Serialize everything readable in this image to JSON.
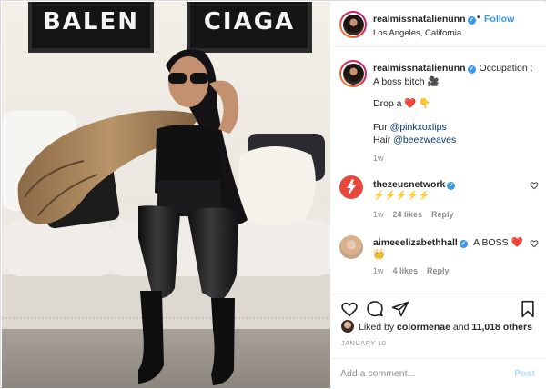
{
  "photo": {
    "sign_left": "BALEN",
    "sign_right": "CIAGA"
  },
  "header": {
    "username": "realmissnatalienunn",
    "separator": "•",
    "follow_label": "Follow",
    "location": "Los Angeles, California"
  },
  "caption": {
    "username": "realmissnatalienunn",
    "text": "Occupation : A boss bitch 🎥",
    "drop_line": "Drop a ❤️ 👇",
    "fur_label": "Fur",
    "fur_mention": "@pinkxoxlips",
    "hair_label": "Hair",
    "hair_mention": "@beezweaves",
    "age": "1w"
  },
  "comments": [
    {
      "username": "thezeusnetwork",
      "text": "⚡⚡⚡⚡⚡",
      "age": "1w",
      "likes": "24 likes",
      "reply": "Reply"
    },
    {
      "username": "aimeeelizabethhall",
      "text": "A BOSS ❤️",
      "text2": "👑",
      "age": "1w",
      "likes": "4 likes",
      "reply": "Reply"
    }
  ],
  "likes": {
    "prefix": "Liked by",
    "user": "colormenae",
    "conj": "and",
    "count": "11,018 others"
  },
  "date": "JANUARY 10",
  "add_comment": {
    "placeholder": "Add a comment...",
    "post_label": "Post"
  },
  "colors": {
    "accent": "#3897f0",
    "post_disabled": "#b2dffc",
    "zeus_red": "#e8473b"
  }
}
